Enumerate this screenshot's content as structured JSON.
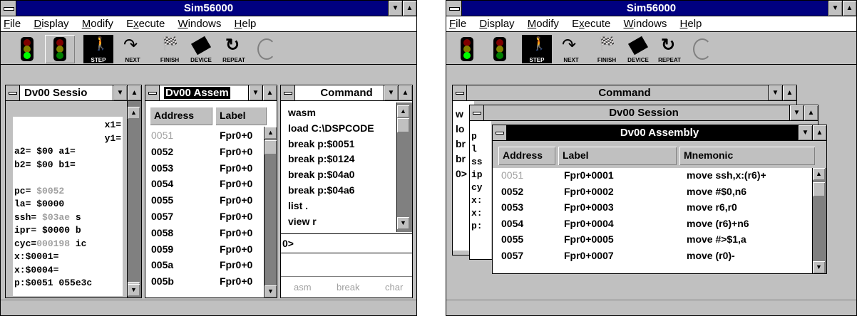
{
  "app_title": "Sim56000",
  "menu": [
    {
      "label": "File",
      "ul": "F"
    },
    {
      "label": "Display",
      "ul": "D"
    },
    {
      "label": "Modify",
      "ul": "M"
    },
    {
      "label": "Execute",
      "ul": "x"
    },
    {
      "label": "Windows",
      "ul": "W"
    },
    {
      "label": "Help",
      "ul": "H"
    }
  ],
  "toolbar": {
    "step": "STEP",
    "next": "NEXT",
    "finish": "FINISH",
    "device": "DEVICE",
    "repeat": "REPEAT"
  },
  "left": {
    "session_title": "Dv00 Sessio",
    "assembly_title": "Dv00 Assem",
    "command_title": "Command",
    "registers": [
      {
        "text": "x1="
      },
      {
        "text": "y1="
      },
      {
        "text": "a2=  $00 a1="
      },
      {
        "text": "b2=  $00 b1="
      },
      {
        "text": ""
      },
      {
        "text": "pc= ",
        "grey": "$0052"
      },
      {
        "text": "la= $0000"
      },
      {
        "text": "ssh= ",
        "grey": "$03ae",
        "tail": "   s"
      },
      {
        "text": "ipr= $0000    b"
      },
      {
        "text": "cyc=",
        "grey": "000198",
        "tail": "  ic"
      },
      {
        "text": "x:$0001="
      },
      {
        "text": "x:$0004="
      },
      {
        "text": "p:$0051 055e3c"
      }
    ],
    "asm_headers": {
      "address": "Address",
      "label": "Label"
    },
    "asm_rows": [
      {
        "addr": "0051",
        "label": "Fpr0+0",
        "grey": true
      },
      {
        "addr": "0052",
        "label": "Fpr0+0"
      },
      {
        "addr": "0053",
        "label": "Fpr0+0"
      },
      {
        "addr": "0054",
        "label": "Fpr0+0"
      },
      {
        "addr": "0055",
        "label": "Fpr0+0"
      },
      {
        "addr": "0057",
        "label": "Fpr0+0"
      },
      {
        "addr": "0058",
        "label": "Fpr0+0"
      },
      {
        "addr": "0059",
        "label": "Fpr0+0"
      },
      {
        "addr": "005a",
        "label": "Fpr0+0"
      },
      {
        "addr": "005b",
        "label": "Fpr0+0"
      }
    ],
    "commands": [
      "wasm",
      "load  C:\\DSPCODE",
      "break p:$0051",
      "break p:$0124",
      "break p:$04a0",
      "break p:$04a6",
      "list .",
      "view r"
    ],
    "prompt": "0>",
    "cmd_footer": [
      "asm",
      "break",
      "char"
    ]
  },
  "right": {
    "command_title": "Command",
    "session_title": "Dv00 Session",
    "assembly_title": "Dv00 Assembly",
    "asm_headers": {
      "address": "Address",
      "label": "Label",
      "mnemonic": "Mnemonic"
    },
    "asm_rows": [
      {
        "addr": "0051",
        "label": "Fpr0+0001",
        "mnem": "move ssh,x:(r6)+",
        "grey": true
      },
      {
        "addr": "0052",
        "label": "Fpr0+0002",
        "mnem": "move #$0,n6"
      },
      {
        "addr": "0053",
        "label": "Fpr0+0003",
        "mnem": "move r6,r0"
      },
      {
        "addr": "0054",
        "label": "Fpr0+0004",
        "mnem": "move (r6)+n6"
      },
      {
        "addr": "0055",
        "label": "Fpr0+0005",
        "mnem": "move #>$1,a"
      },
      {
        "addr": "0057",
        "label": "Fpr0+0007",
        "mnem": "move (r0)-"
      }
    ],
    "bg_cmd_peek": [
      "w",
      "lo",
      "br",
      "br",
      "0>"
    ],
    "bg_sess_peek": [
      "p",
      "l",
      "ss",
      "ip",
      "cy",
      "x:",
      "x:",
      "p:"
    ]
  }
}
